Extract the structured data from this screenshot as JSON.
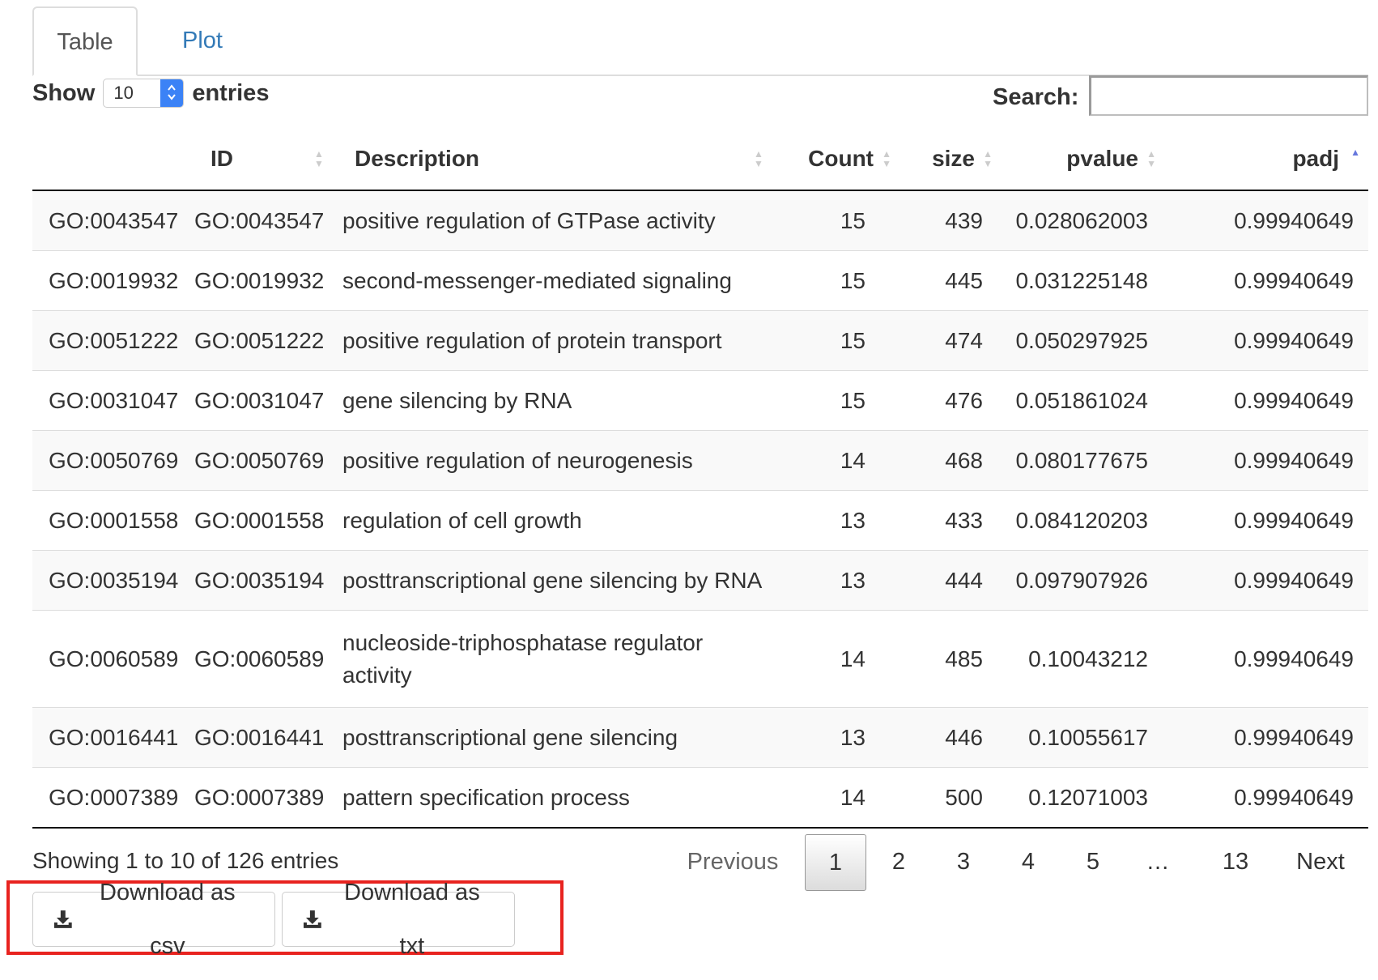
{
  "tabs": [
    {
      "label": "Table",
      "active": true
    },
    {
      "label": "Plot",
      "active": false
    }
  ],
  "length_control": {
    "show_label": "Show",
    "value": "10",
    "entries_label": "entries"
  },
  "search": {
    "label": "Search:",
    "value": "",
    "placeholder": ""
  },
  "table": {
    "columns": [
      "",
      "ID",
      "Description",
      "Count",
      "size",
      "pvalue",
      "padj"
    ],
    "sorted_column": "padj",
    "sort_direction": "ascending",
    "rows": [
      [
        "GO:0043547",
        "GO:0043547",
        "positive regulation of GTPase activity",
        "15",
        "439",
        "0.028062003",
        "0.99940649"
      ],
      [
        "GO:0019932",
        "GO:0019932",
        "second-messenger-mediated signaling",
        "15",
        "445",
        "0.031225148",
        "0.99940649"
      ],
      [
        "GO:0051222",
        "GO:0051222",
        "positive regulation of protein transport",
        "15",
        "474",
        "0.050297925",
        "0.99940649"
      ],
      [
        "GO:0031047",
        "GO:0031047",
        "gene silencing by RNA",
        "15",
        "476",
        "0.051861024",
        "0.99940649"
      ],
      [
        "GO:0050769",
        "GO:0050769",
        "positive regulation of neurogenesis",
        "14",
        "468",
        "0.080177675",
        "0.99940649"
      ],
      [
        "GO:0001558",
        "GO:0001558",
        "regulation of cell growth",
        "13",
        "433",
        "0.084120203",
        "0.99940649"
      ],
      [
        "GO:0035194",
        "GO:0035194",
        "posttranscriptional gene silencing by RNA",
        "13",
        "444",
        "0.097907926",
        "0.99940649"
      ],
      [
        "GO:0060589",
        "GO:0060589",
        "nucleoside-triphosphatase regulator activity",
        "14",
        "485",
        "0.10043212",
        "0.99940649"
      ],
      [
        "GO:0016441",
        "GO:0016441",
        "posttranscriptional gene silencing",
        "13",
        "446",
        "0.10055617",
        "0.99940649"
      ],
      [
        "GO:0007389",
        "GO:0007389",
        "pattern specification process",
        "14",
        "500",
        "0.12071003",
        "0.99940649"
      ]
    ]
  },
  "info_text": "Showing 1 to 10 of 126 entries",
  "pagination": {
    "previous": "Previous",
    "pages": [
      "1",
      "2",
      "3",
      "4",
      "5",
      "…",
      "13"
    ],
    "current": "1",
    "next": "Next"
  },
  "buttons": {
    "download_csv": "Download as csv",
    "download_txt": "Download as txt"
  },
  "icons": {
    "download": "download-icon",
    "sort": "sort-icon"
  },
  "colors": {
    "link": "#337ab7",
    "highlight": "#e8231f",
    "stripe": "#f9f9f9"
  }
}
